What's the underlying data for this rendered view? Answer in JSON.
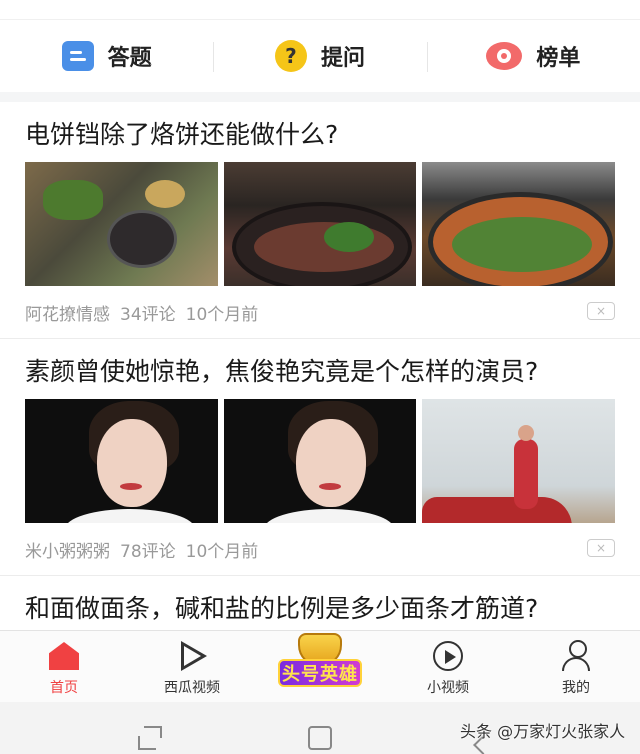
{
  "action_bar": {
    "items": [
      {
        "label": "答题",
        "icon": "answer-icon"
      },
      {
        "label": "提问",
        "icon": "question-icon",
        "glyph": "?"
      },
      {
        "label": "榜单",
        "icon": "ranking-icon"
      }
    ]
  },
  "feed": {
    "articles": [
      {
        "title": "电饼铛除了烙饼还能做什么?",
        "source": "阿花撩情感",
        "comments": "34评论",
        "time": "10个月前",
        "dismiss": "×"
      },
      {
        "title": "素颜曾使她惊艳，焦俊艳究竟是个怎样的演员?",
        "source": "米小粥粥粥",
        "comments": "78评论",
        "time": "10个月前",
        "dismiss": "×"
      },
      {
        "title": "和面做面条，碱和盐的比例是多少面条才筋道?"
      }
    ]
  },
  "tabbar": {
    "tabs": [
      {
        "label": "首页",
        "icon": "home-icon",
        "active": true
      },
      {
        "label": "西瓜视频",
        "icon": "play-icon"
      },
      {
        "label": "头号英雄",
        "icon": "trophy-badge-icon"
      },
      {
        "label": "小视频",
        "icon": "mini-video-icon"
      },
      {
        "label": "我的",
        "icon": "profile-icon"
      }
    ]
  },
  "watermark": "头条 @万家灯火张家人",
  "colors": {
    "accent": "#f04142",
    "answer_icon": "#4a8fe7",
    "question_icon": "#f5c518",
    "ranking_icon": "#f26a6a"
  }
}
